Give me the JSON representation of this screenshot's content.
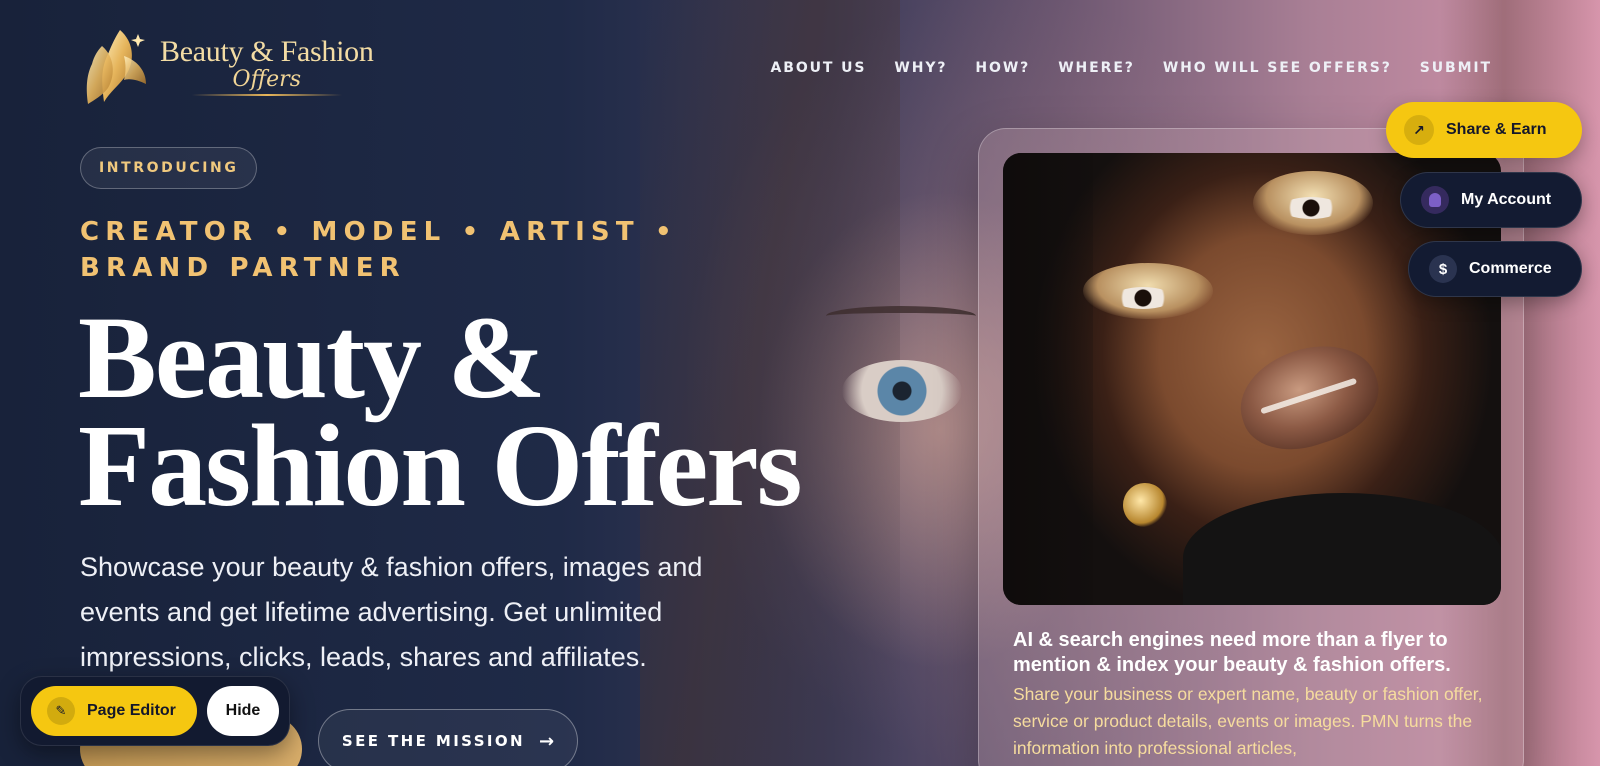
{
  "brand": {
    "line1": "Beauty & Fashion",
    "line2": "Offers"
  },
  "nav": {
    "items": [
      {
        "label": "ABOUT US"
      },
      {
        "label": "WHY?"
      },
      {
        "label": "HOW?"
      },
      {
        "label": "WHERE?"
      },
      {
        "label": "WHO WILL SEE OFFERS?"
      },
      {
        "label": "SUBMIT"
      }
    ]
  },
  "floating": {
    "share": {
      "label": "Share & Earn",
      "icon": "arrow-up-right-icon"
    },
    "account": {
      "label": "My Account",
      "icon": "user-avatar-icon"
    },
    "commerce": {
      "label": "Commerce",
      "icon": "dollar-icon",
      "glyph": "$"
    }
  },
  "hero": {
    "badge": "INTRODUCING",
    "roles": "CREATOR • MODEL • ARTIST • BRAND PARTNER",
    "title": "Beauty & Fashion Offers",
    "lead": "Showcase your beauty & fashion offers, images and events and get lifetime advertising. Get unlimited impressions, clicks, leads, shares and affiliates.",
    "mission_label": "SEE THE MISSION",
    "mission_arrow": "→"
  },
  "editor": {
    "label": "Page Editor",
    "hide_label": "Hide",
    "icon": "pencil-icon"
  },
  "card": {
    "title": "AI & search engines need more than a flyer to mention & index your beauty & fashion offers.",
    "body": "Share your business or expert name, beauty or fashion offer, service or product details, events or images. PMN turns the information into professional articles,"
  },
  "colors": {
    "accent_yellow": "#f5c711",
    "gold_text": "#f1c272",
    "navy": "#131b32"
  }
}
